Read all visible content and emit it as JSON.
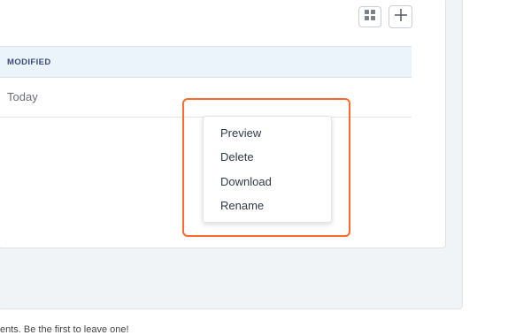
{
  "toolbar": {
    "grid_icon": "grid-icon",
    "add_icon": "plus-icon"
  },
  "table": {
    "columns": [
      "MODIFIED"
    ],
    "rows": [
      {
        "modified": "Today"
      }
    ]
  },
  "context_menu": {
    "items": [
      "Preview",
      "Delete",
      "Download",
      "Rename"
    ]
  },
  "footer": {
    "text": "ents. Be the first to leave one!"
  },
  "colors": {
    "highlight": "#ff6a2b",
    "header_bg": "#eaf4fa",
    "header_text": "#3b4a7a",
    "panel_bg": "#f1f4f7"
  }
}
